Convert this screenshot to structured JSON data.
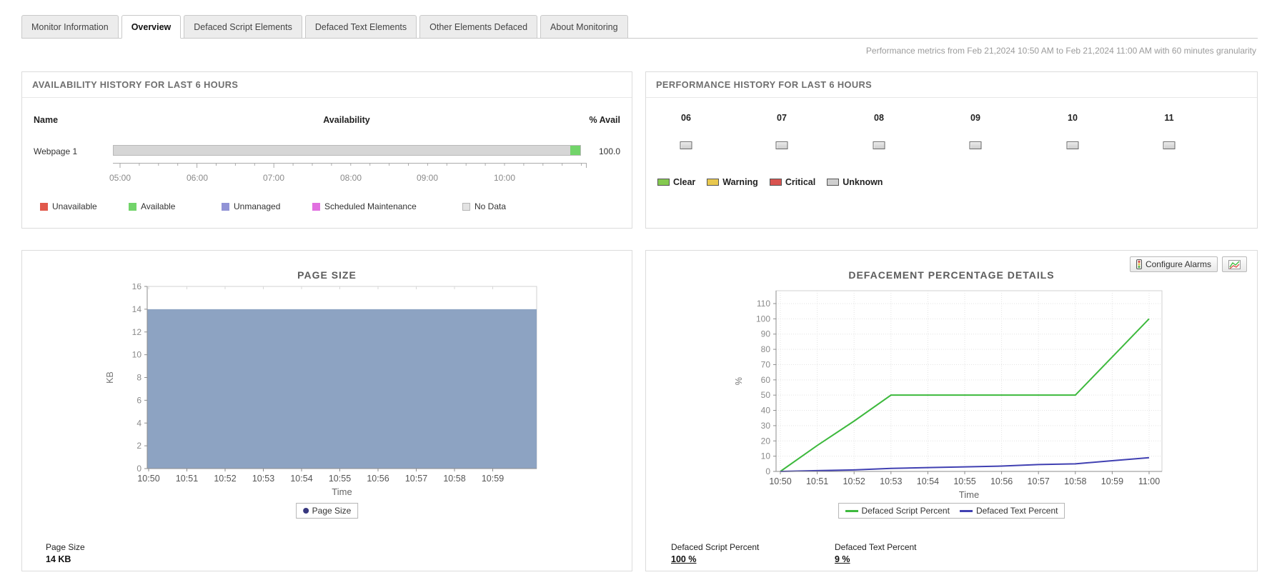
{
  "tabs": [
    {
      "label": "Monitor Information"
    },
    {
      "label": "Overview"
    },
    {
      "label": "Defaced Script Elements"
    },
    {
      "label": "Defaced Text Elements"
    },
    {
      "label": "Other Elements Defaced"
    },
    {
      "label": "About Monitoring"
    }
  ],
  "header": {
    "metrics_note": "Performance metrics from Feb 21,2024 10:50 AM to Feb 21,2024 11:00 AM with 60 minutes granularity"
  },
  "availability": {
    "title": "AVAILABILITY HISTORY FOR LAST 6 HOURS",
    "columns": {
      "name": "Name",
      "availability": "Availability",
      "percent": "% Avail"
    },
    "row": {
      "name": "Webpage 1",
      "percent": "100.0",
      "segments": [
        {
          "status": "no-data",
          "color": "#d6d6d6",
          "pct": 97.8
        },
        {
          "status": "available",
          "color": "#72d46a",
          "pct": 2.2
        }
      ]
    },
    "axis_labels": [
      "05:00",
      "06:00",
      "07:00",
      "08:00",
      "09:00",
      "10:00"
    ],
    "legend": [
      {
        "label": "Unavailable",
        "color": "#e1584b"
      },
      {
        "label": "Available",
        "color": "#72d46a"
      },
      {
        "label": "Unmanaged",
        "color": "#9193d6"
      },
      {
        "label": "Scheduled Maintenance",
        "color": "#e170e0"
      },
      {
        "label": "No Data",
        "color": "#e3e3e3"
      }
    ]
  },
  "performance": {
    "title": "PERFORMANCE HISTORY FOR LAST 6 HOURS",
    "hours": [
      "06",
      "07",
      "08",
      "09",
      "10",
      "11"
    ],
    "status": "Unknown",
    "legend": [
      {
        "label": "Clear",
        "color": "#84c94f"
      },
      {
        "label": "Warning",
        "color": "#e8c84e"
      },
      {
        "label": "Critical",
        "color": "#d9534f"
      },
      {
        "label": "Unknown",
        "color": "#cfcfcf"
      }
    ]
  },
  "page_size_panel": {
    "title": "PAGE SIZE",
    "legend_label": "Page Size",
    "legend_marker_color": "#38387f",
    "stat_label": "Page Size",
    "stat_value": "14 KB",
    "chart_data": {
      "type": "area",
      "x": [
        "10:50",
        "10:51",
        "10:52",
        "10:53",
        "10:54",
        "10:55",
        "10:56",
        "10:57",
        "10:58",
        "10:59"
      ],
      "series": [
        {
          "name": "Page Size",
          "color": "#8da3c2",
          "values": [
            14,
            14,
            14,
            14,
            14,
            14,
            14,
            14,
            14,
            14
          ]
        }
      ],
      "title": "PAGE SIZE",
      "xlabel": "Time",
      "ylabel": "KB",
      "ylim": [
        0,
        16
      ],
      "ytick": 2,
      "grid": false,
      "legend_position": "bottom"
    }
  },
  "defacement_panel": {
    "title": "DEFACEMENT PERCENTAGE DETAILS",
    "configure_alarms_label": "Configure Alarms",
    "stats": [
      {
        "label": "Defaced Script Percent",
        "value": "100 %"
      },
      {
        "label": "Defaced Text Percent",
        "value": "9 %"
      }
    ],
    "chart_data": {
      "type": "line",
      "x": [
        "10:50",
        "10:51",
        "10:52",
        "10:53",
        "10:54",
        "10:55",
        "10:56",
        "10:57",
        "10:58",
        "10:59",
        "11:00"
      ],
      "series": [
        {
          "name": "Defaced Script Percent",
          "color": "#3db93d",
          "values": [
            0,
            17,
            33,
            50,
            50,
            50,
            50,
            50,
            50,
            75,
            100
          ]
        },
        {
          "name": "Defaced Text Percent",
          "color": "#4040b2",
          "values": [
            0,
            0.5,
            1,
            2,
            2.5,
            3,
            3.5,
            4.5,
            5,
            7,
            9
          ]
        }
      ],
      "title": "DEFACEMENT PERCENTAGE DETAILS",
      "xlabel": "Time",
      "ylabel": "%",
      "ylim": [
        0,
        110
      ],
      "ytick": 10,
      "grid": true,
      "legend_position": "bottom"
    }
  }
}
